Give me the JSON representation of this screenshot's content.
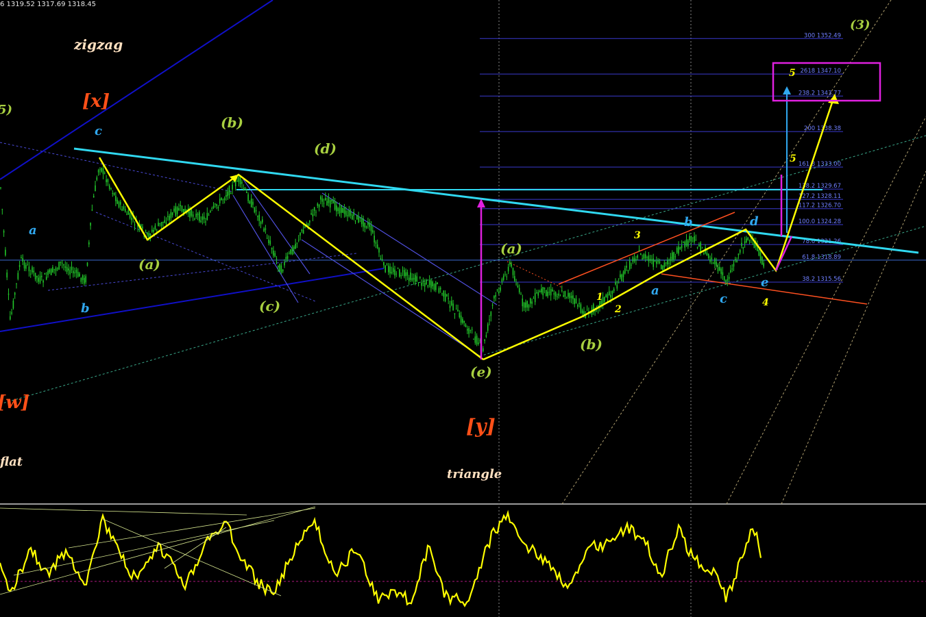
{
  "header": {
    "ohlc_text": "6 1319.52 1317.69 1318.45"
  },
  "colors": {
    "background": "#000000",
    "candles": "#22c82a",
    "zigzag": "#ffff00",
    "trendline": "#30d8f0",
    "channel_blue": "#1010c8",
    "channel_lines": "#5050e0",
    "fib_lines": "#3a3ad0",
    "fib_text": "#6f7fff",
    "target_box": "#e020e0",
    "orange_lines": "#ff5020",
    "oscillator": "#ffff00",
    "wave_green": "#a8d040",
    "wave_blue": "#30a8f0",
    "wave_orange": "#ff5018",
    "wave_cream": "#ffe0c0"
  },
  "chart_data": {
    "type": "line",
    "title": "",
    "xlabel": "",
    "ylabel": "",
    "fib_levels": [
      {
        "ratio": "300",
        "price": "1352.49"
      },
      {
        "ratio": "2618",
        "price": "1347.10"
      },
      {
        "ratio": "238.2",
        "price": "1343.77"
      },
      {
        "ratio": "200",
        "price": "1338.38"
      },
      {
        "ratio": "161.8",
        "price": "1333.00"
      },
      {
        "ratio": "138.2",
        "price": "1329.67"
      },
      {
        "ratio": "127.2",
        "price": "1328.11"
      },
      {
        "ratio": "117.2",
        "price": "1326.70"
      },
      {
        "ratio": "100.0",
        "price": "1324.28"
      },
      {
        "ratio": "78.6",
        "price": "1321.26"
      },
      {
        "ratio": "61.8",
        "price": "1318.89"
      },
      {
        "ratio": "38.2",
        "price": "1315.56"
      }
    ],
    "wave_labels": {
      "zigzag": "zigzag",
      "flat": "flat",
      "triangle": "triangle",
      "w": "[w]",
      "x": "[x]",
      "y": "[y]",
      "three": "(3)",
      "five_left": "5)",
      "a_paren": "(a)",
      "b_paren": "(b)",
      "c_paren": "(c)",
      "d_paren": "(d)",
      "e_paren": "(e)",
      "a": "a",
      "b": "b",
      "c": "c",
      "d": "d",
      "e": "e",
      "n1": "1",
      "n2": "2",
      "n3": "3",
      "n4": "4",
      "n5": "5"
    },
    "series": [
      {
        "name": "price",
        "values": []
      },
      {
        "name": "oscillator",
        "values": []
      }
    ]
  }
}
